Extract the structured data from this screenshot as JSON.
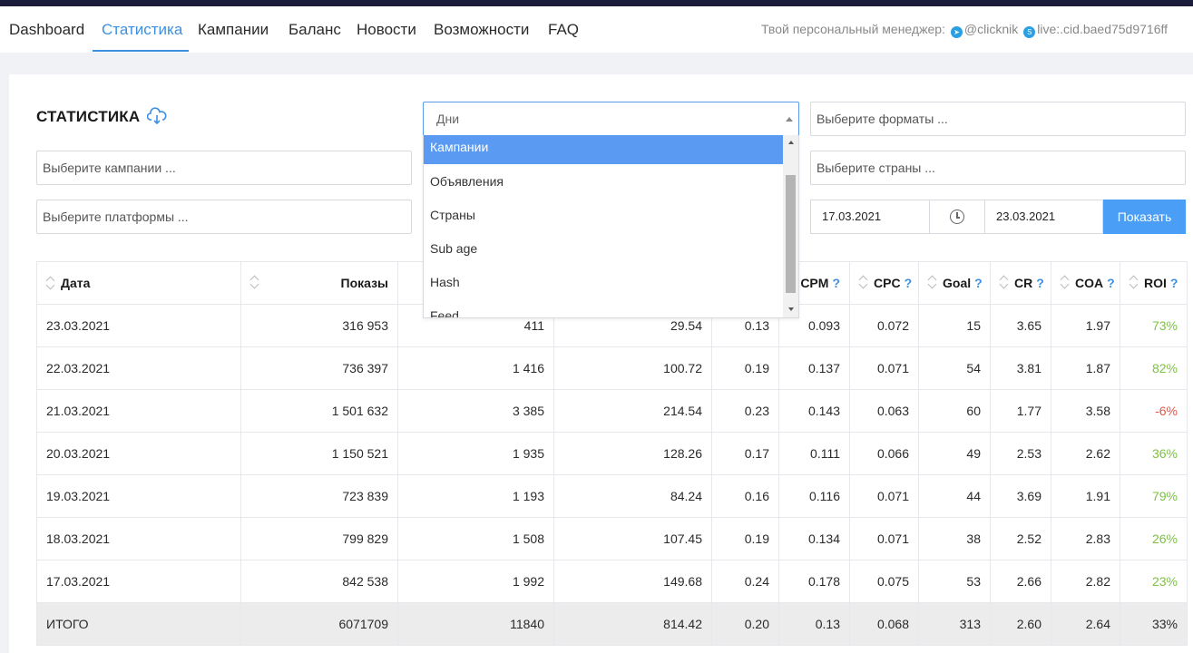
{
  "nav": {
    "items": [
      "Dashboard",
      "Статистика",
      "Кампании",
      "Баланс",
      "Новости",
      "Возможности",
      "FAQ"
    ],
    "active": "Статистика",
    "manager_label": "Твой персональный менеджер:",
    "telegram": "@clicknik",
    "skype": "live:.cid.baed75d9716ff"
  },
  "page": {
    "title": "СТАТИСТИКА"
  },
  "filters": {
    "group_by_value": "Дни",
    "formats_placeholder": "Выберите форматы ...",
    "campaigns_placeholder": "Выберите кампании ...",
    "countries_placeholder": "Выберите страны ...",
    "platforms_placeholder": "Выберите платформы ...",
    "date_from": "17.03.2021",
    "date_to": "23.03.2021",
    "show_button": "Показать"
  },
  "dropdown": {
    "options": [
      "Кампании",
      "Объявления",
      "Страны",
      "Sub age",
      "Hash",
      "Feed"
    ],
    "highlighted": "Кампании"
  },
  "table": {
    "headers": {
      "date": "Дата",
      "shows": "Показы",
      "cpm": "CPM",
      "cpc": "CPC",
      "goal": "Goal",
      "cr": "CR",
      "coa": "COA",
      "roi": "ROI",
      "help": "?"
    },
    "rows": [
      {
        "date": "23.03.2021",
        "shows": "316 953",
        "c3": "411",
        "c4": "29.54",
        "c5": "0.13",
        "cpm": "0.093",
        "cpc": "0.072",
        "goal": "15",
        "cr": "3.65",
        "coa": "1.97",
        "roi": "73%"
      },
      {
        "date": "22.03.2021",
        "shows": "736 397",
        "c3": "1 416",
        "c4": "100.72",
        "c5": "0.19",
        "cpm": "0.137",
        "cpc": "0.071",
        "goal": "54",
        "cr": "3.81",
        "coa": "1.87",
        "roi": "82%"
      },
      {
        "date": "21.03.2021",
        "shows": "1 501 632",
        "c3": "3 385",
        "c4": "214.54",
        "c5": "0.23",
        "cpm": "0.143",
        "cpc": "0.063",
        "goal": "60",
        "cr": "1.77",
        "coa": "3.58",
        "roi": "-6%"
      },
      {
        "date": "20.03.2021",
        "shows": "1 150 521",
        "c3": "1 935",
        "c4": "128.26",
        "c5": "0.17",
        "cpm": "0.111",
        "cpc": "0.066",
        "goal": "49",
        "cr": "2.53",
        "coa": "2.62",
        "roi": "36%"
      },
      {
        "date": "19.03.2021",
        "shows": "723 839",
        "c3": "1 193",
        "c4": "84.24",
        "c5": "0.16",
        "cpm": "0.116",
        "cpc": "0.071",
        "goal": "44",
        "cr": "3.69",
        "coa": "1.91",
        "roi": "79%"
      },
      {
        "date": "18.03.2021",
        "shows": "799 829",
        "c3": "1 508",
        "c4": "107.45",
        "c5": "0.19",
        "cpm": "0.134",
        "cpc": "0.071",
        "goal": "38",
        "cr": "2.52",
        "coa": "2.83",
        "roi": "26%"
      },
      {
        "date": "17.03.2021",
        "shows": "842 538",
        "c3": "1 992",
        "c4": "149.68",
        "c5": "0.24",
        "cpm": "0.178",
        "cpc": "0.075",
        "goal": "53",
        "cr": "2.66",
        "coa": "2.82",
        "roi": "23%"
      }
    ],
    "total": {
      "label": "ИТОГО",
      "shows": "6071709",
      "c3": "11840",
      "c4": "814.42",
      "c5": "0.20",
      "cpm": "0.13",
      "cpc": "0.068",
      "goal": "313",
      "cr": "2.60",
      "coa": "2.64",
      "roi": "33%"
    }
  },
  "colors": {
    "accent": "#3d8fe0",
    "positive": "#7dc243",
    "negative": "#e0574c",
    "button": "#4a9ef5",
    "highlight": "#5a9af2"
  }
}
